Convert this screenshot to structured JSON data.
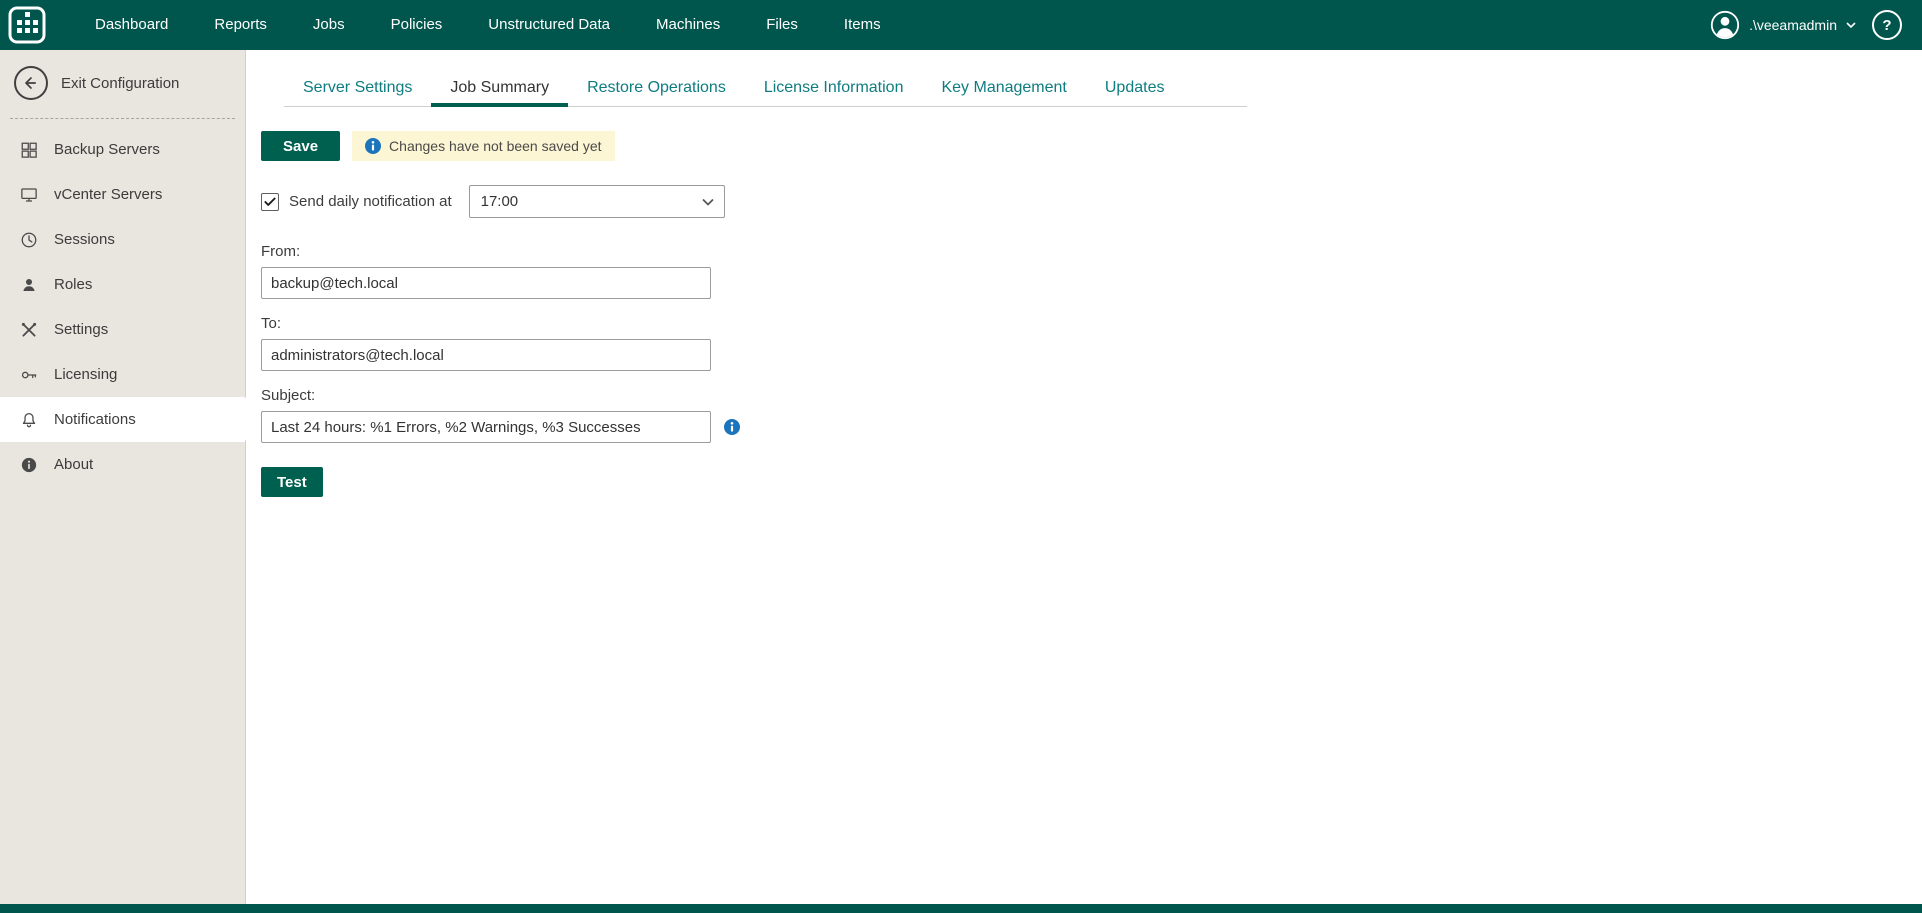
{
  "header": {
    "nav": [
      {
        "label": "Dashboard"
      },
      {
        "label": "Reports"
      },
      {
        "label": "Jobs"
      },
      {
        "label": "Policies"
      },
      {
        "label": "Unstructured Data"
      },
      {
        "label": "Machines"
      },
      {
        "label": "Files"
      },
      {
        "label": "Items"
      }
    ],
    "user_name": ".\\veeamadmin",
    "help_label": "?"
  },
  "sidebar": {
    "exit_label": "Exit Configuration",
    "items": [
      {
        "label": "Backup Servers",
        "icon": "backup-servers-icon"
      },
      {
        "label": "vCenter Servers",
        "icon": "vcenter-servers-icon"
      },
      {
        "label": "Sessions",
        "icon": "sessions-clock-icon"
      },
      {
        "label": "Roles",
        "icon": "roles-person-icon"
      },
      {
        "label": "Settings",
        "icon": "settings-tools-icon"
      },
      {
        "label": "Licensing",
        "icon": "licensing-key-icon"
      },
      {
        "label": "Notifications",
        "icon": "notifications-bell-icon"
      },
      {
        "label": "About",
        "icon": "about-info-icon"
      }
    ],
    "selected_item": "Notifications"
  },
  "tabs": [
    {
      "label": "Server Settings"
    },
    {
      "label": "Job Summary"
    },
    {
      "label": "Restore Operations"
    },
    {
      "label": "License Information"
    },
    {
      "label": "Key Management"
    },
    {
      "label": "Updates"
    }
  ],
  "active_tab": "Job Summary",
  "content": {
    "save_label": "Save",
    "unsaved_note": "Changes have not been saved yet",
    "daily_checkbox_label": "Send daily notification at",
    "daily_checkbox_checked": true,
    "time_value": "17:00",
    "from_label": "From:",
    "from_value": "backup@tech.local",
    "to_label": "To:",
    "to_value": "administrators@tech.local",
    "subject_label": "Subject:",
    "subject_value": "Last 24 hours: %1 Errors, %2 Warnings, %3 Successes",
    "test_label": "Test"
  },
  "colors": {
    "header_bg": "#00564c",
    "accent_green": "#00604f",
    "tab_teal": "#0e7c80",
    "sidebar_bg": "#e9e5df",
    "note_bg": "#fcf6d4",
    "info_blue": "#1c75bc"
  }
}
